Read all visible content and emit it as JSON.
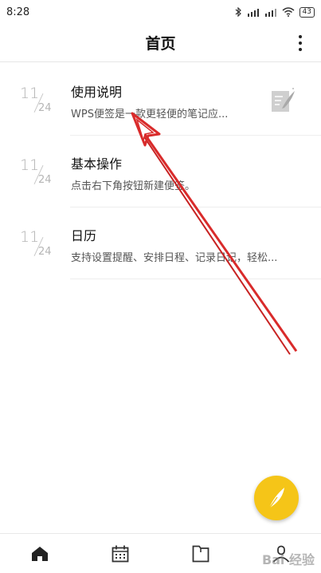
{
  "status_bar": {
    "time": "8:28",
    "battery": "43"
  },
  "header": {
    "title": "首页"
  },
  "notes": [
    {
      "month": "11",
      "day": "24",
      "title": "使用说明",
      "snippet": "WPS便签是一款更轻便的笔记应...",
      "has_thumbnail": true
    },
    {
      "month": "11",
      "day": "24",
      "title": "基本操作",
      "snippet": "点击右下角按钮新建便签。",
      "has_thumbnail": false
    },
    {
      "month": "11",
      "day": "24",
      "title": "日历",
      "snippet": "支持设置提醒、安排日程、记录日记，轻松...",
      "has_thumbnail": false
    }
  ],
  "bottom_nav": [
    {
      "icon": "home-icon"
    },
    {
      "icon": "calendar-icon"
    },
    {
      "icon": "folder-icon"
    },
    {
      "icon": "profile-icon"
    }
  ],
  "colors": {
    "accent": "#f5c518",
    "annotation_arrow": "#d92b2b"
  },
  "watermark": "Bai 经验"
}
